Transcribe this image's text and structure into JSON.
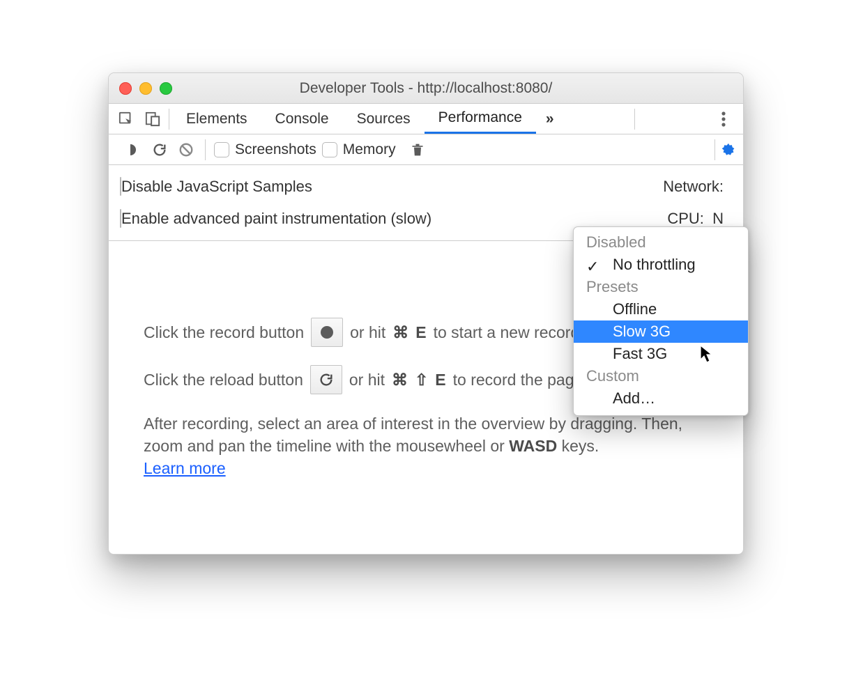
{
  "window_title": "Developer Tools - http://localhost:8080/",
  "tabs": {
    "elements": "Elements",
    "console": "Console",
    "sources": "Sources",
    "performance": "Performance",
    "overflow": "»"
  },
  "secondary": {
    "screenshots": "Screenshots",
    "memory": "Memory"
  },
  "settings": {
    "disable_js_samples": "Disable JavaScript Samples",
    "enable_paint": "Enable advanced paint instrumentation (slow)",
    "network_label": "Network:",
    "cpu_label": "CPU:",
    "cpu_value": "N"
  },
  "instructions": {
    "record_pre": "Click the record button",
    "record_post_1": "or hit",
    "record_key_cmd": "⌘",
    "record_key_E": "E",
    "record_post_2": "to start a new recording.",
    "reload_pre": "Click the reload button",
    "reload_post_1": "or hit",
    "reload_key_cmd": "⌘",
    "reload_key_shift": "⇧",
    "reload_key_E": "E",
    "reload_post_2": "to record the page load.",
    "para": "After recording, select an area of interest in the overview by dragging. Then, zoom and pan the timeline with the mousewheel or ",
    "wasd": "WASD",
    "para_tail": " keys.",
    "learn_more": "Learn more"
  },
  "dropdown": {
    "group_disabled": "Disabled",
    "no_throttling": "No throttling",
    "group_presets": "Presets",
    "offline": "Offline",
    "slow3g": "Slow 3G",
    "fast3g": "Fast 3G",
    "group_custom": "Custom",
    "add": "Add…"
  }
}
